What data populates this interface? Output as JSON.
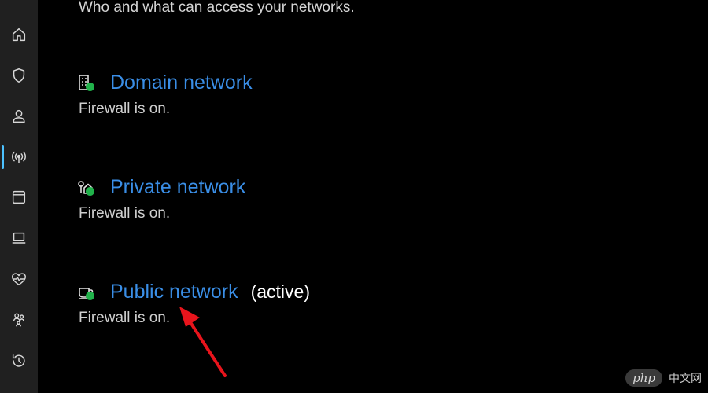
{
  "header": {
    "subtitle": "Who and what can access your networks."
  },
  "sidebar": {
    "items": [
      {
        "icon": "home-icon"
      },
      {
        "icon": "shield-icon"
      },
      {
        "icon": "person-icon"
      },
      {
        "icon": "network-antenna-icon",
        "active": true
      },
      {
        "icon": "app-window-icon"
      },
      {
        "icon": "laptop-icon"
      },
      {
        "icon": "heart-pulse-icon"
      },
      {
        "icon": "family-icon"
      },
      {
        "icon": "history-icon"
      }
    ],
    "accent_color": "#4cc2ff"
  },
  "networks": [
    {
      "title": "Domain network",
      "status": "Firewall is on.",
      "icon": "domain-building-icon",
      "active_label": ""
    },
    {
      "title": "Private network",
      "status": "Firewall is on.",
      "icon": "private-home-icon",
      "active_label": ""
    },
    {
      "title": "Public network",
      "status": "Firewall is on.",
      "icon": "public-coffee-icon",
      "active_label": "(active)"
    }
  ],
  "colors": {
    "link": "#3a8ee6",
    "check": "#21b24b",
    "arrow": "#e8141c"
  },
  "watermark": {
    "badge": "php",
    "text": "中文网"
  }
}
